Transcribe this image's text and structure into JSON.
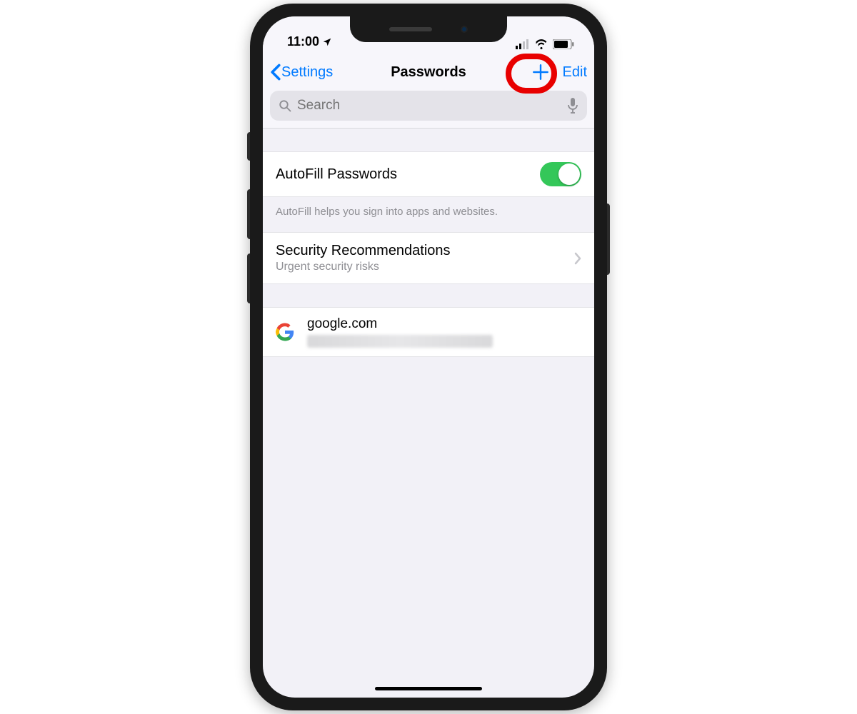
{
  "status": {
    "time": "11:00"
  },
  "nav": {
    "back_label": "Settings",
    "title": "Passwords",
    "edit_label": "Edit"
  },
  "search": {
    "placeholder": "Search"
  },
  "autofill": {
    "label": "AutoFill Passwords",
    "footer": "AutoFill helps you sign into apps and websites.",
    "enabled": true
  },
  "security": {
    "title": "Security Recommendations",
    "subtitle": "Urgent security risks"
  },
  "entries": [
    {
      "site": "google.com",
      "icon": "google-icon"
    }
  ],
  "annotation": {
    "highlight_target": "add-button"
  }
}
